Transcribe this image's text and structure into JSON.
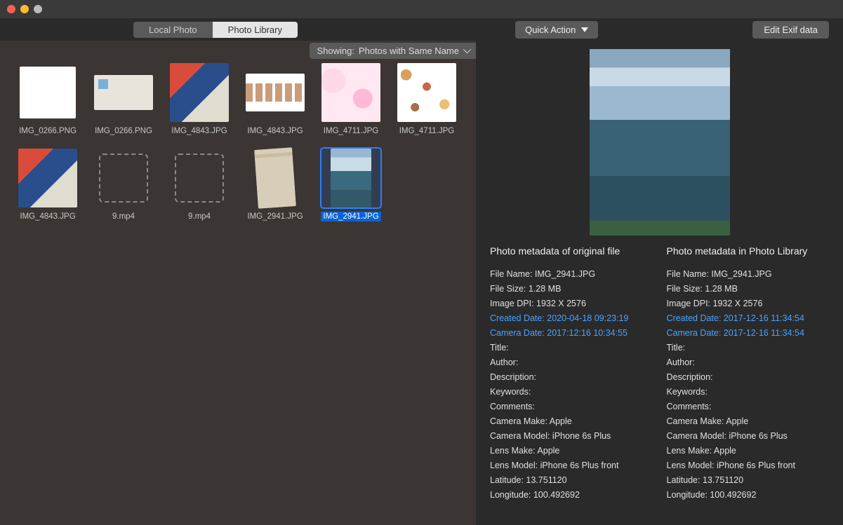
{
  "tabs": {
    "local": "Local Photo",
    "library": "Photo Library"
  },
  "buttons": {
    "quick_action": "Quick Action",
    "edit_exif": "Edit Exif data"
  },
  "filter": {
    "prefix": "Showing:",
    "value": "Photos with Same Name"
  },
  "thumbnails": [
    {
      "label": "IMG_0266.PNG",
      "style": "tt-white"
    },
    {
      "label": "IMG_0266.PNG",
      "style": "tt-doc"
    },
    {
      "label": "IMG_4843.JPG",
      "style": "tt-collage"
    },
    {
      "label": "IMG_4843.JPG",
      "style": "tt-tape"
    },
    {
      "label": "IMG_4711.JPG",
      "style": "tt-pink"
    },
    {
      "label": "IMG_4711.JPG",
      "style": "tt-food"
    },
    {
      "label": "IMG_4843.JPG",
      "style": "tt-collage"
    },
    {
      "label": "9.mp4",
      "style": "placeholder"
    },
    {
      "label": "9.mp4",
      "style": "placeholder"
    },
    {
      "label": "IMG_2941.JPG",
      "style": "tt-news"
    },
    {
      "label": "IMG_2941.JPG",
      "style": "tt-seasky",
      "selected": true
    }
  ],
  "meta_titles": {
    "left": "Photo metadata of original file",
    "right": "Photo metadata in Photo Library"
  },
  "meta_left": [
    {
      "text": "File Name: IMG_2941.JPG"
    },
    {
      "text": "File Size: 1.28 MB"
    },
    {
      "text": "Image DPI: 1932 X 2576"
    },
    {
      "text": "Created Date: 2020-04-18 09:23:19",
      "hl": true
    },
    {
      "text": "Camera Date: 2017:12:16 10:34:55",
      "hl": true
    },
    {
      "text": "Title:"
    },
    {
      "text": "Author:"
    },
    {
      "text": "Description:"
    },
    {
      "text": "Keywords:"
    },
    {
      "text": "Comments:"
    },
    {
      "text": "Camera Make: Apple"
    },
    {
      "text": "Camera Model: iPhone 6s Plus"
    },
    {
      "text": "Lens Make: Apple"
    },
    {
      "text": "Lens Model: iPhone 6s Plus front"
    },
    {
      "text": "Latitude: 13.751120"
    },
    {
      "text": "Longitude: 100.492692"
    }
  ],
  "meta_right": [
    {
      "text": "File Name: IMG_2941.JPG"
    },
    {
      "text": "File Size: 1.28 MB"
    },
    {
      "text": "Image DPI: 1932 X 2576"
    },
    {
      "text": "Created Date: 2017-12-16 11:34:54",
      "hl": true
    },
    {
      "text": "Camera Date: 2017-12-16 11:34:54",
      "hl": true
    },
    {
      "text": "Title:"
    },
    {
      "text": "Author:"
    },
    {
      "text": "Description:"
    },
    {
      "text": "Keywords:"
    },
    {
      "text": "Comments:"
    },
    {
      "text": "Camera Make: Apple"
    },
    {
      "text": "Camera Model: iPhone 6s Plus"
    },
    {
      "text": "Lens Make: Apple"
    },
    {
      "text": "Lens Model: iPhone 6s Plus front"
    },
    {
      "text": "Latitude: 13.751120"
    },
    {
      "text": "Longitude: 100.492692"
    }
  ]
}
